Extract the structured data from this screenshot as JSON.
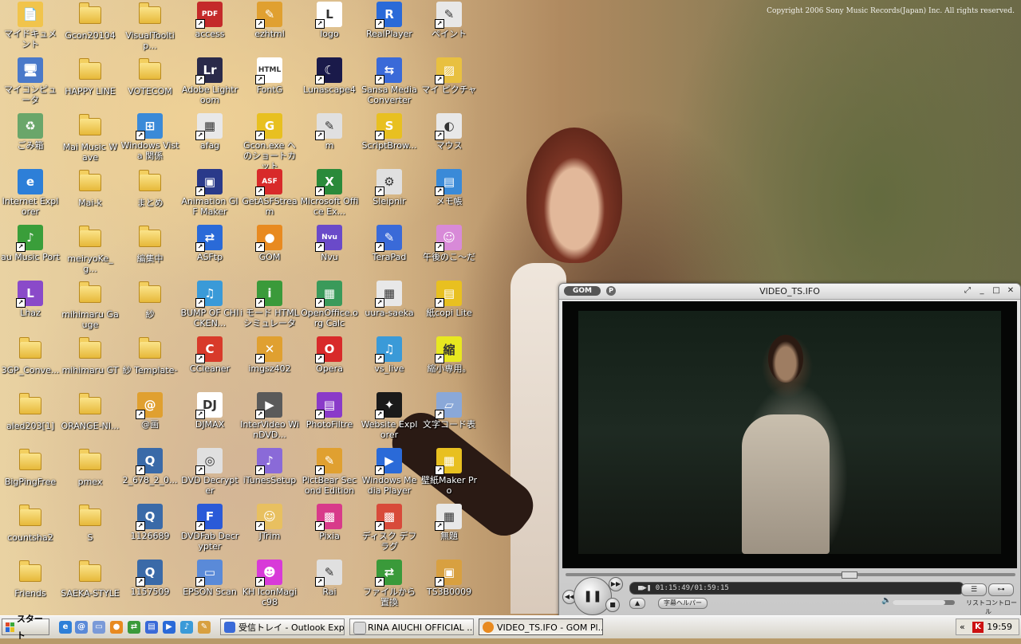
{
  "wallpaper": {
    "copyright": "Copyright 2006 Sony Music Records(Japan) Inc. All rights reserved."
  },
  "desktop_icons": [
    {
      "label": "マイドキュメント",
      "type": "mydocs",
      "color": "#f1c44b",
      "glyph": "📄"
    },
    {
      "label": "マイコンピュータ",
      "type": "computer",
      "color": "#4a79c9",
      "glyph": "🖥"
    },
    {
      "label": "ごみ箱",
      "type": "recycle",
      "color": "#6aa66a",
      "glyph": "♻"
    },
    {
      "label": "Internet Explorer",
      "type": "ie",
      "color": "#2d7fd8",
      "glyph": "e"
    },
    {
      "label": "au Music Port",
      "type": "app",
      "color": "#3a9e3a",
      "glyph": "♪"
    },
    {
      "label": "Lhaz",
      "type": "app",
      "color": "#8a4ac9",
      "glyph": "L"
    },
    {
      "label": "3GP_Conve...",
      "type": "folder"
    },
    {
      "label": "aled203[1]",
      "type": "folder"
    },
    {
      "label": "BigPingFree",
      "type": "folder"
    },
    {
      "label": "countsha2",
      "type": "folder"
    },
    {
      "label": "Friends",
      "type": "folder"
    },
    {
      "label": "Gcon20104",
      "type": "folder"
    },
    {
      "label": "HAPPY LINE",
      "type": "folder"
    },
    {
      "label": "Mai Music Wave",
      "type": "folder"
    },
    {
      "label": "Mai-k",
      "type": "folder"
    },
    {
      "label": "meiryoKe_g...",
      "type": "folder"
    },
    {
      "label": "mihimaru Gauge",
      "type": "folder"
    },
    {
      "label": "mihimaru GT",
      "type": "folder"
    },
    {
      "label": "ORANGE-NI...",
      "type": "folder"
    },
    {
      "label": "pmex",
      "type": "folder"
    },
    {
      "label": "S",
      "type": "folder"
    },
    {
      "label": "SAEKA-STYLE",
      "type": "folder"
    },
    {
      "label": "VisualTooltip...",
      "type": "folder"
    },
    {
      "label": "VOTECOM",
      "type": "folder"
    },
    {
      "label": "Windows Vista 関係",
      "type": "app",
      "color": "#3a8ad8",
      "glyph": "⊞"
    },
    {
      "label": "まとめ",
      "type": "folder"
    },
    {
      "label": "編集中",
      "type": "folder"
    },
    {
      "label": "紗",
      "type": "folder"
    },
    {
      "label": "紗 Template-",
      "type": "folder"
    },
    {
      "label": "@画",
      "type": "app",
      "color": "#e0a030",
      "glyph": "@"
    },
    {
      "label": "2_678_2_0...",
      "type": "app",
      "color": "#3a6aa8",
      "glyph": "Q"
    },
    {
      "label": "1126689",
      "type": "app",
      "color": "#3a6aa8",
      "glyph": "Q"
    },
    {
      "label": "1157509",
      "type": "app",
      "color": "#3a6aa8",
      "glyph": "Q"
    },
    {
      "label": "access",
      "type": "app",
      "color": "#c42a2a",
      "glyph": "PDF"
    },
    {
      "label": "Adobe Lightroom",
      "type": "app",
      "color": "#2a2a4a",
      "glyph": "Lr"
    },
    {
      "label": "afag",
      "type": "app",
      "color": "#e8e8e8",
      "glyph": "▦"
    },
    {
      "label": "Animation GIF Maker",
      "type": "app",
      "color": "#2a3a8a",
      "glyph": "▣"
    },
    {
      "label": "ASFtp",
      "type": "app",
      "color": "#2a6ad8",
      "glyph": "⇄"
    },
    {
      "label": "BUMP OF CHICKEN...",
      "type": "app",
      "color": "#3a9ad8",
      "glyph": "♫"
    },
    {
      "label": "CCleaner",
      "type": "app",
      "color": "#d83a2a",
      "glyph": "C"
    },
    {
      "label": "DJMAX",
      "type": "app",
      "color": "#ffffff",
      "glyph": "DJ"
    },
    {
      "label": "DVD Decrypter",
      "type": "app",
      "color": "#e0e0e0",
      "glyph": "◎"
    },
    {
      "label": "DVDFab Decrypter",
      "type": "app",
      "color": "#2a5ad8",
      "glyph": "F"
    },
    {
      "label": "EPSON Scan",
      "type": "app",
      "color": "#5a8ad8",
      "glyph": "▭"
    },
    {
      "label": "ezhtml",
      "type": "app",
      "color": "#e0a030",
      "glyph": "✎"
    },
    {
      "label": "FontG",
      "type": "app",
      "color": "#ffffff",
      "glyph": "HTML"
    },
    {
      "label": "Gcon.exe へのショートカット",
      "type": "app",
      "color": "#e8c020",
      "glyph": "G"
    },
    {
      "label": "GetASFStream",
      "type": "app",
      "color": "#d82a2a",
      "glyph": "ASF"
    },
    {
      "label": "GOM",
      "type": "app",
      "color": "#e88a20",
      "glyph": "●"
    },
    {
      "label": "i モード HTML シミュレータ",
      "type": "app",
      "color": "#3a9a3a",
      "glyph": "i"
    },
    {
      "label": "imgsz402",
      "type": "app",
      "color": "#e0a030",
      "glyph": "✕"
    },
    {
      "label": "InterVideo WinDVD...",
      "type": "app",
      "color": "#5a5a5a",
      "glyph": "▶"
    },
    {
      "label": "iTunesSetup",
      "type": "app",
      "color": "#8a6ad8",
      "glyph": "♪"
    },
    {
      "label": "JTrim",
      "type": "app",
      "color": "#e8c060",
      "glyph": "☺"
    },
    {
      "label": "KH IconMagic98",
      "type": "app",
      "color": "#d83ad8",
      "glyph": "☻"
    },
    {
      "label": "logo",
      "type": "app",
      "color": "#ffffff",
      "glyph": "L"
    },
    {
      "label": "Lunascape4",
      "type": "app",
      "color": "#1a1a4a",
      "glyph": "☾"
    },
    {
      "label": "m",
      "type": "app",
      "color": "#e0e0e0",
      "glyph": "✎"
    },
    {
      "label": "Microsoft Office Ex...",
      "type": "app",
      "color": "#2a8a3a",
      "glyph": "X"
    },
    {
      "label": "Nvu",
      "type": "app",
      "color": "#6a4ac9",
      "glyph": "Nvu"
    },
    {
      "label": "OpenOffice.org Calc",
      "type": "app",
      "color": "#3a9a5a",
      "glyph": "▦"
    },
    {
      "label": "Opera",
      "type": "app",
      "color": "#d82a2a",
      "glyph": "O"
    },
    {
      "label": "PhotoFiltre",
      "type": "app",
      "color": "#8a3ac9",
      "glyph": "▤"
    },
    {
      "label": "PictBear Second Edition",
      "type": "app",
      "color": "#e0a030",
      "glyph": "✎"
    },
    {
      "label": "Pixia",
      "type": "app",
      "color": "#d83a8a",
      "glyph": "▩"
    },
    {
      "label": "Rai",
      "type": "app",
      "color": "#e0e0e0",
      "glyph": "✎"
    },
    {
      "label": "RealPlayer",
      "type": "app",
      "color": "#2a6ad8",
      "glyph": "R"
    },
    {
      "label": "Sansa Media Converter",
      "type": "app",
      "color": "#3a6ad8",
      "glyph": "⇆"
    },
    {
      "label": "ScriptBrow...",
      "type": "app",
      "color": "#e8c020",
      "glyph": "S"
    },
    {
      "label": "Sleipnir",
      "type": "app",
      "color": "#e0e0e0",
      "glyph": "⚙"
    },
    {
      "label": "TeraPad",
      "type": "app",
      "color": "#3a6ad8",
      "glyph": "✎"
    },
    {
      "label": "uura-saeka",
      "type": "app",
      "color": "#e8e8e8",
      "glyph": "▦"
    },
    {
      "label": "vs_live",
      "type": "app",
      "color": "#3a9ad8",
      "glyph": "♫"
    },
    {
      "label": "Website Explorer",
      "type": "app",
      "color": "#1a1a1a",
      "glyph": "✦"
    },
    {
      "label": "Windows Media Player",
      "type": "app",
      "color": "#2a6ad8",
      "glyph": "▶"
    },
    {
      "label": "ディスク デフラグ",
      "type": "app",
      "color": "#d84a3a",
      "glyph": "▩"
    },
    {
      "label": "ファイルから置換",
      "type": "app",
      "color": "#3a9a3a",
      "glyph": "⇄"
    },
    {
      "label": "ペイント",
      "type": "app",
      "color": "#e8e8e8",
      "glyph": "✎"
    },
    {
      "label": "マイ ピクチャ",
      "type": "app",
      "color": "#e8c040",
      "glyph": "▨"
    },
    {
      "label": "マウス",
      "type": "app",
      "color": "#e8e8e8",
      "glyph": "◐"
    },
    {
      "label": "メモ帳",
      "type": "app",
      "color": "#3a8ad8",
      "glyph": "▤"
    },
    {
      "label": "午後のこ〜だ",
      "type": "app",
      "color": "#d88ad8",
      "glyph": "☺"
    },
    {
      "label": "紙copi Lite",
      "type": "app",
      "color": "#e8c020",
      "glyph": "▤"
    },
    {
      "label": "縮小専用。",
      "type": "app",
      "color": "#e8e820",
      "glyph": "縮"
    },
    {
      "label": "文字コード表",
      "type": "app",
      "color": "#8aa8d8",
      "glyph": "▱"
    },
    {
      "label": "壁紙Maker Pro",
      "type": "app",
      "color": "#e8c020",
      "glyph": "▦"
    },
    {
      "label": "無題",
      "type": "app",
      "color": "#e8e8e8",
      "glyph": "▦"
    },
    {
      "label": "TS3B0009",
      "type": "app",
      "color": "#d8a040",
      "glyph": "▣"
    }
  ],
  "player": {
    "logo": "GOM",
    "p_button": "P",
    "title": "VIDEO_TS.IFO",
    "time": "01:15:49/01:59:15",
    "progress": 0.634,
    "volume": 0.85,
    "btn_a": "▲",
    "btn_subtitle": "字幕ヘルパー",
    "list_label": "リスト",
    "control_label": "コントロール"
  },
  "taskbar": {
    "start": "スタート",
    "tasks": [
      {
        "label": "受信トレイ - Outlook Exp...",
        "color": "#3a6ad8"
      },
      {
        "label": "RINA AIUCHI OFFICIAL ...",
        "color": "#d8d8d8"
      },
      {
        "label": "VIDEO_TS.IFO - GOM Pl...",
        "color": "#e88a20"
      }
    ],
    "clock": "19:59",
    "tray_k": "K"
  }
}
